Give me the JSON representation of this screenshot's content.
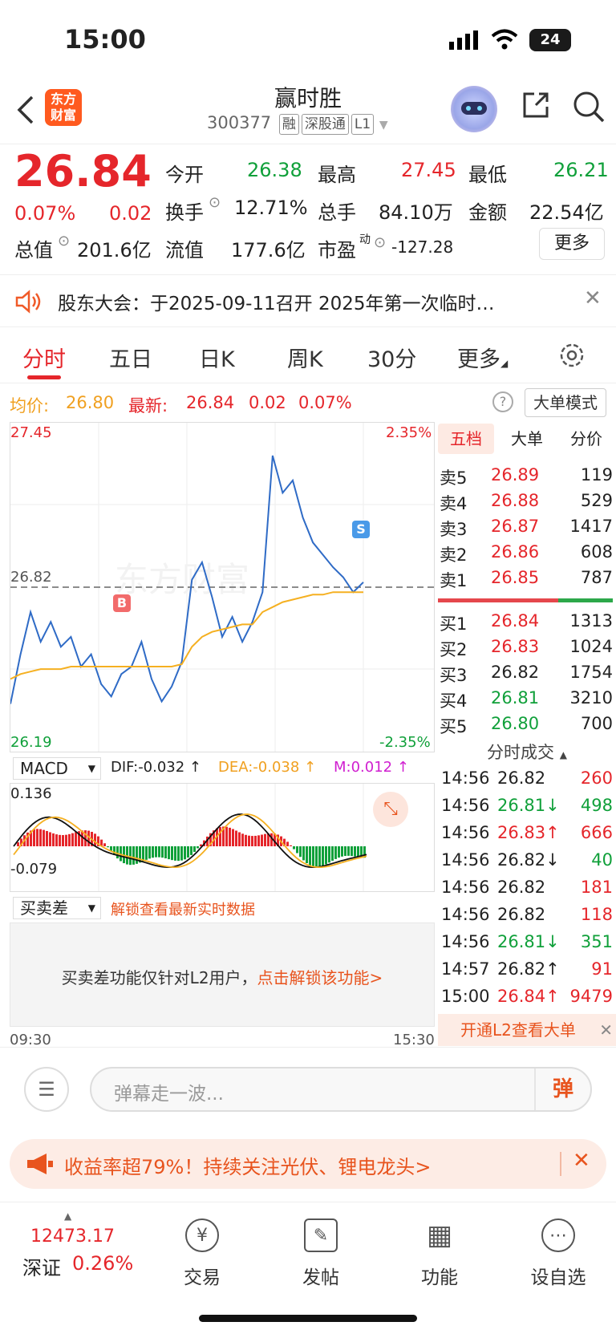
{
  "status": {
    "time": "15:00",
    "battery": "24"
  },
  "header": {
    "logo_line1": "东方",
    "logo_line2": "财富",
    "stock_name": "赢时胜",
    "code": "300377",
    "tags": [
      "融",
      "深股通",
      "L1"
    ]
  },
  "quote": {
    "price": "26.84",
    "pct": "0.07%",
    "change": "0.02",
    "open_label": "今开",
    "open": "26.38",
    "high_label": "最高",
    "high": "27.45",
    "low_label": "最低",
    "low": "26.21",
    "turnover_label": "换手",
    "turnover": "12.71%",
    "volume_label": "总手",
    "volume": "84.10万",
    "amount_label": "金额",
    "amount": "22.54亿",
    "mcap_label": "总值",
    "mcap": "201.6亿",
    "float_label": "流值",
    "float": "177.6亿",
    "pe_label": "市盈",
    "pe_sup": "动",
    "pe": "-127.28",
    "more": "更多"
  },
  "notice": {
    "text": "股东大会：于2025-09-11召开 2025年第一次临时…"
  },
  "tabs": [
    {
      "label": "分时",
      "active": true
    },
    {
      "label": "五日"
    },
    {
      "label": "日K"
    },
    {
      "label": "周K"
    },
    {
      "label": "30分"
    },
    {
      "label": "更多"
    }
  ],
  "legend": {
    "avg_label": "均价:",
    "avg": "26.80",
    "latest_label": "最新:",
    "latest": "26.84",
    "chg": "0.02",
    "pct": "0.07%",
    "mode": "大单模式"
  },
  "chart": {
    "top_price": "27.45",
    "bottom_price": "26.19",
    "mid_price": "26.82",
    "top_pct": "2.35%",
    "bottom_pct": "-2.35%",
    "watermark": "东方财富",
    "buy_marker": "B",
    "sell_marker": "S",
    "start_time": "09:30",
    "end_time": "15:30"
  },
  "chart_data": {
    "type": "line",
    "title": "",
    "ylim": [
      26.19,
      27.45
    ],
    "series": [
      {
        "name": "",
        "values": [
          26.35,
          26.55,
          26.72,
          26.6,
          26.68,
          26.58,
          26.62,
          26.5,
          26.55,
          26.43,
          26.38,
          26.47,
          26.5,
          26.6,
          26.45,
          26.36,
          26.42,
          26.52,
          26.85,
          26.92,
          26.78,
          26.62,
          26.7,
          26.6,
          26.68,
          26.8,
          27.35,
          27.2,
          27.25,
          27.1,
          27.0,
          26.95,
          26.9,
          26.86,
          26.8,
          26.84
        ]
      },
      {
        "name": "",
        "values": [
          26.45,
          26.47,
          26.48,
          26.49,
          26.49,
          26.49,
          26.5,
          26.5,
          26.5,
          26.5,
          26.5,
          26.5,
          26.5,
          26.5,
          26.5,
          26.5,
          26.5,
          26.51,
          26.58,
          26.62,
          26.64,
          26.65,
          26.66,
          26.67,
          26.67,
          26.72,
          26.74,
          26.76,
          26.77,
          26.78,
          26.79,
          26.79,
          26.8,
          26.8,
          26.8,
          26.8
        ]
      }
    ]
  },
  "book": {
    "tabs": [
      "五档",
      "大单",
      "分价"
    ],
    "asks": [
      {
        "label": "卖5",
        "price": "26.89",
        "vol": "119"
      },
      {
        "label": "卖4",
        "price": "26.88",
        "vol": "529"
      },
      {
        "label": "卖3",
        "price": "26.87",
        "vol": "1417"
      },
      {
        "label": "卖2",
        "price": "26.86",
        "vol": "608"
      },
      {
        "label": "卖1",
        "price": "26.85",
        "vol": "787"
      }
    ],
    "bids": [
      {
        "label": "买1",
        "price": "26.84",
        "vol": "1313"
      },
      {
        "label": "买2",
        "price": "26.83",
        "vol": "1024"
      },
      {
        "label": "买3",
        "price": "26.82",
        "vol": "1754"
      },
      {
        "label": "买4",
        "price": "26.81",
        "vol": "3210"
      },
      {
        "label": "买5",
        "price": "26.80",
        "vol": "700"
      }
    ]
  },
  "ticks": {
    "title": "分时成交",
    "rows": [
      {
        "time": "14:56",
        "price": "26.82",
        "vol": "260"
      },
      {
        "time": "14:56",
        "price": "26.81↓",
        "vol": "498"
      },
      {
        "time": "14:56",
        "price": "26.83↑",
        "vol": "666"
      },
      {
        "time": "14:56",
        "price": "26.82↓",
        "vol": "40"
      },
      {
        "time": "14:56",
        "price": "26.82",
        "vol": "181"
      },
      {
        "time": "14:56",
        "price": "26.82",
        "vol": "118"
      },
      {
        "time": "14:56",
        "price": "26.81↓",
        "vol": "351"
      },
      {
        "time": "14:57",
        "price": "26.82↑",
        "vol": "91"
      },
      {
        "time": "15:00",
        "price": "26.84↑",
        "vol": "9479"
      }
    ],
    "l2_link": "开通L2查看大单"
  },
  "macd": {
    "label": "MACD",
    "dif": "DIF:-0.032 ↑",
    "dea": "DEA:-0.038 ↑",
    "m": "M:0.012 ↑",
    "top": "0.136",
    "bottom": "-0.079"
  },
  "maimai": {
    "label": "买卖差",
    "unlock": "解锁查看最新实时数据",
    "msg": "买卖差功能仅针对L2用户，",
    "link": "点击解锁该功能>"
  },
  "danmu": {
    "placeholder": "弹幕走一波...",
    "send": "弹"
  },
  "promo": {
    "text": "收益率超79%！持续关注光伏、锂电龙头>"
  },
  "bottom": {
    "index_value": "12473.17",
    "index_name": "深证",
    "index_pct": "0.26%",
    "items": [
      {
        "label": "交易",
        "icon": "¥"
      },
      {
        "label": "发帖",
        "icon": "✎"
      },
      {
        "label": "功能",
        "icon": "▦"
      },
      {
        "label": "设自选",
        "icon": "⋯"
      }
    ]
  }
}
